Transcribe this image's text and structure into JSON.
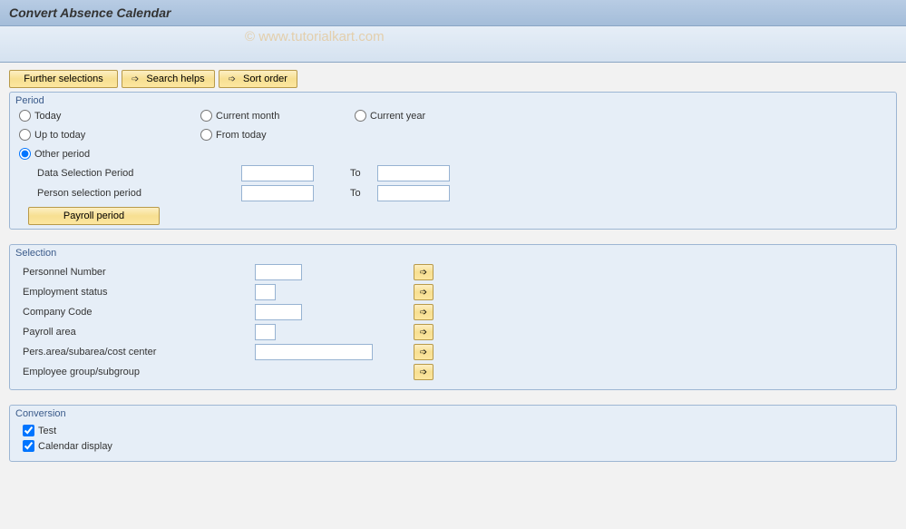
{
  "header": {
    "title": "Convert Absence Calendar"
  },
  "watermark": "© www.tutorialkart.com",
  "toolbar": {
    "further_selections": "Further selections",
    "search_helps": "Search helps",
    "sort_order": "Sort order"
  },
  "period": {
    "title": "Period",
    "radios": {
      "today": "Today",
      "current_month": "Current month",
      "current_year": "Current year",
      "up_to_today": "Up to today",
      "from_today": "From today",
      "other_period": "Other period"
    },
    "data_selection_label": "Data Selection Period",
    "person_selection_label": "Person selection period",
    "to_label": "To",
    "payroll_period_btn": "Payroll period",
    "data_from": "",
    "data_to": "",
    "person_from": "",
    "person_to": ""
  },
  "selection": {
    "title": "Selection",
    "rows": {
      "personnel_number": "Personnel Number",
      "employment_status": "Employment status",
      "company_code": "Company Code",
      "payroll_area": "Payroll area",
      "pers_area": "Pers.area/subarea/cost center",
      "employee_group": "Employee group/subgroup"
    },
    "values": {
      "personnel_number": "",
      "employment_status": "",
      "company_code": "",
      "payroll_area": "",
      "pers_area": "",
      "employee_group": ""
    }
  },
  "conversion": {
    "title": "Conversion",
    "test_label": "Test",
    "calendar_display_label": "Calendar display"
  }
}
